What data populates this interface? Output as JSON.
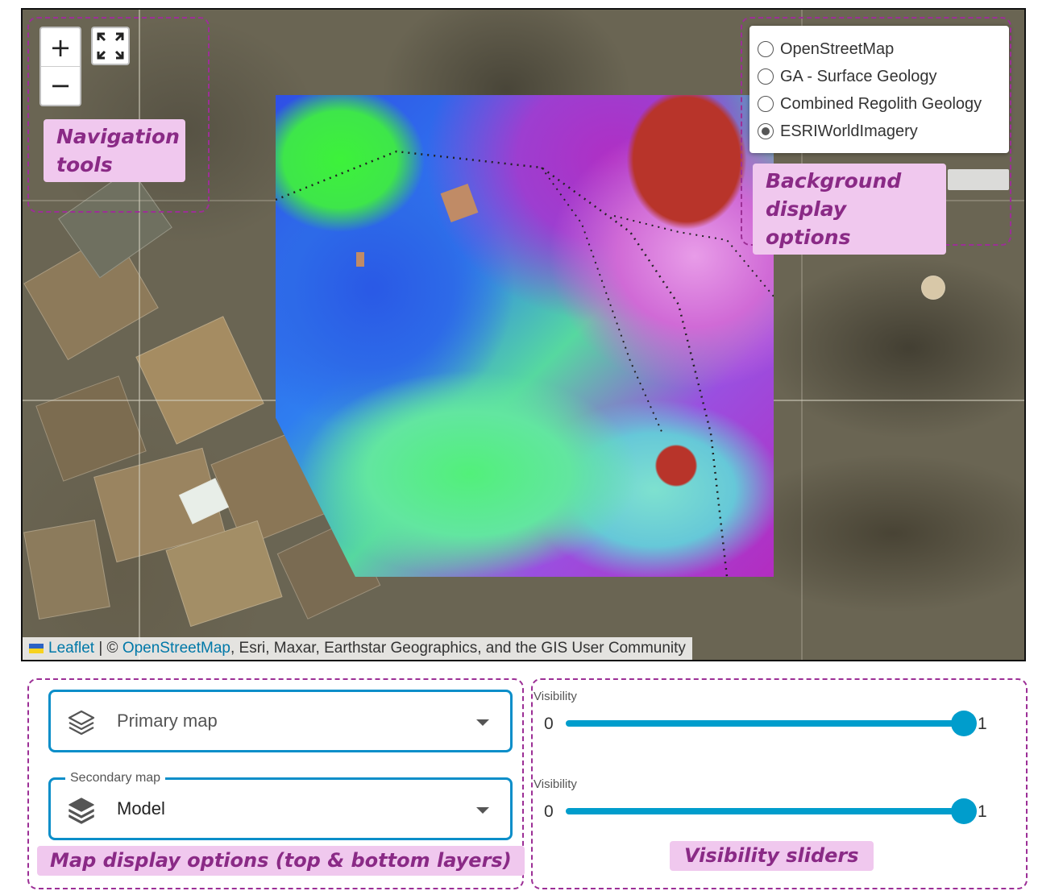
{
  "map": {
    "zoom_in_label": "+",
    "zoom_out_label": "−",
    "fullscreen_icon": "fullscreen-icon",
    "base_layers": [
      {
        "label": "OpenStreetMap",
        "checked": false
      },
      {
        "label": "GA - Surface Geology",
        "checked": false
      },
      {
        "label": "Combined Regolith Geology",
        "checked": false
      },
      {
        "label": "ESRIWorldImagery",
        "checked": true
      }
    ],
    "attribution": {
      "leaflet": "Leaflet",
      "separator": " | © ",
      "osm": "OpenStreetMap",
      "rest": ", Esri, Maxar, Earthstar Geographics, and the GIS User Community"
    }
  },
  "annotations": {
    "navigation": "Navigation tools",
    "background": "Background display options",
    "map_display": "Map display options (top & bottom layers)",
    "visibility": "Visibility sliders"
  },
  "controls": {
    "primary_map": {
      "placeholder": "Primary map",
      "icon": "layers-outline-icon"
    },
    "secondary_map": {
      "legend": "Secondary map",
      "value": "Model",
      "icon": "layers-filled-icon"
    }
  },
  "sliders": [
    {
      "label": "Visibility",
      "min": "0",
      "max": "1",
      "value": 1
    },
    {
      "label": "Visibility",
      "min": "0",
      "max": "1",
      "value": 1
    }
  ],
  "colors": {
    "accent": "#009dcc",
    "select_border": "#0b8ec9",
    "annotation_border": "#9c2f96",
    "annotation_fill": "#f0c8ee",
    "annotation_text": "#8a2a86"
  }
}
